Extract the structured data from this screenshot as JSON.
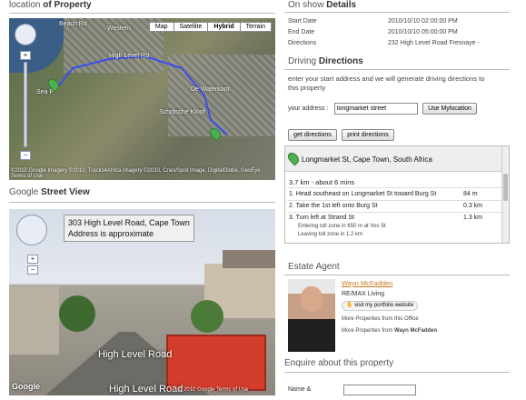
{
  "location": {
    "title_pre": "location ",
    "title_bold": "of Property"
  },
  "map": {
    "types": [
      "Map",
      "Satellite",
      "Hybrid",
      "Terrain"
    ],
    "selected_type": "Hybrid",
    "road_labels": [
      "High Level Rd",
      "Western",
      "De Waterkant",
      "Schotsche Kloof",
      "Sea P",
      "Beach Rd"
    ],
    "attribution": "©2010 Google  Imagery ©2010, Tracks4Africa Imagery ©2010, Cnes/Spot Image, DigitalGlobe, GeoEye  Terms of Use",
    "zoom_in": "+",
    "zoom_out": "−"
  },
  "street_view": {
    "title_pre": "Google ",
    "title_bold": "Street View",
    "address": "303 High Level Road, Cape Town",
    "approx": "Address is approximate",
    "road_label": "High Level Road",
    "road_label_2": "High Level Road",
    "zoom_in": "+",
    "zoom_out": "−",
    "logo": "Google",
    "attribution": "© 2010 Google  Terms of Use"
  },
  "on_show": {
    "title_pre": "On show ",
    "title_bold": "Details",
    "rows": [
      {
        "k": "Start Date",
        "v": "2010/10/10 02:00:00 PM"
      },
      {
        "k": "End Date",
        "v": "2010/10/10 05:00:00 PM"
      },
      {
        "k": "Directions",
        "v": "232 High Level Road Fresnaye -"
      }
    ]
  },
  "driving": {
    "title_pre": "Driving ",
    "title_bold": "Directions",
    "intro": "enter your start address and we will generate driving directions to this property",
    "addr_label": "your address :",
    "addr_value": "longmarket street",
    "use_mylocation": "Use Mylocation",
    "get_directions": "get directions",
    "print_directions": "print directions",
    "start": "Longmarket St, Cape Town, South Africa",
    "summary": "3.7 km - about 6 mins",
    "steps": [
      {
        "n": "1.",
        "text": "Head southeast on Longmarket St toward Burg St",
        "dist": "84 m"
      },
      {
        "n": "2.",
        "text": "Take the 1st left onto Burg St",
        "dist": "0.3 km"
      },
      {
        "n": "3.",
        "text": "Turn left at Strand St",
        "dist": "1.3 km"
      }
    ],
    "sub1": "Entering toll zone in 650 m at Vos St",
    "sub2": "Leaving toll zone in 1.2 km"
  },
  "agent": {
    "title": "Estate Agent",
    "name": "Wayn McFadden",
    "company": "RE/MAX Living",
    "portfolio": "visit my portfolio website",
    "more_office": "More Properties from this Office",
    "more_agent_pre": "More Properties from ",
    "more_agent_bold": "Wayn McFadden"
  },
  "enquire": {
    "title": "Enquire about this property",
    "name_label": "Name &"
  }
}
